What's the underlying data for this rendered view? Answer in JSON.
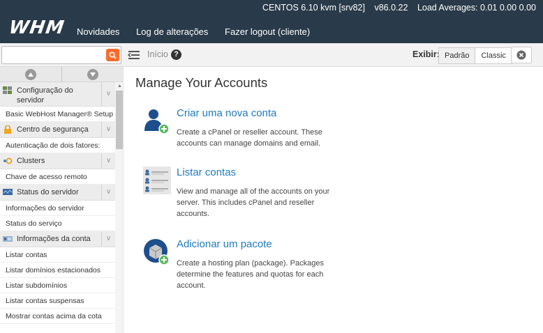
{
  "header": {
    "logo": "WHM",
    "hostname": "CENTOS 6.10 kvm [srv82]",
    "version": "v86.0.22",
    "load_averages": "Load Averages: 0.01 0.00 0.00",
    "nav": [
      "Novidades",
      "Log de alterações",
      "Fazer logout (cliente)"
    ]
  },
  "toolbar": {
    "search_placeholder": "",
    "breadcrumb": "Início",
    "view_label": "Exibir:",
    "view_options": [
      "Padrão",
      "Classic"
    ],
    "selected_view": "Padrão"
  },
  "sidebar": {
    "sections": [
      {
        "type": "category",
        "label": "Configuração do servidor",
        "icon": "server-config-icon"
      },
      {
        "type": "item",
        "label": "Basic WebHost Manager® Setup"
      },
      {
        "type": "category",
        "label": "Centro de segurança",
        "icon": "lock-icon"
      },
      {
        "type": "item",
        "label": "Autenticação de dois fatores:"
      },
      {
        "type": "category",
        "label": "Clusters",
        "icon": "clusters-icon"
      },
      {
        "type": "item",
        "label": "Chave de acesso remoto"
      },
      {
        "type": "category",
        "label": "Status do servidor",
        "icon": "monitor-icon"
      },
      {
        "type": "item",
        "label": "Informações do servidor"
      },
      {
        "type": "item",
        "label": "Status do serviço"
      },
      {
        "type": "category",
        "label": "Informações da conta",
        "icon": "account-info-icon"
      },
      {
        "type": "item",
        "label": "Listar contas"
      },
      {
        "type": "item",
        "label": "Listar domínios estacionados"
      },
      {
        "type": "item",
        "label": "Listar subdomínios"
      },
      {
        "type": "item",
        "label": "Listar contas suspensas"
      },
      {
        "type": "item",
        "label": "Mostrar contas acima da cota"
      }
    ]
  },
  "main": {
    "title": "Manage Your Accounts",
    "items": [
      {
        "title": "Criar uma nova conta",
        "description": "Create a cPanel or reseller account. These accounts can manage domains and email.",
        "icon": "add-user-icon"
      },
      {
        "title": "Listar contas",
        "description": "View and manage all of the accounts on your server. This includes cPanel and reseller accounts.",
        "icon": "user-list-icon"
      },
      {
        "title": "Adicionar um pacote",
        "description": "Create a hosting plan (package). Packages determine the features and quotas for each account.",
        "icon": "add-package-icon"
      }
    ]
  },
  "colors": {
    "header_bg": "#293a4a",
    "link": "#1f7bbf",
    "search_accent": "#ff6c2c",
    "add_badge": "#5cb85c"
  }
}
